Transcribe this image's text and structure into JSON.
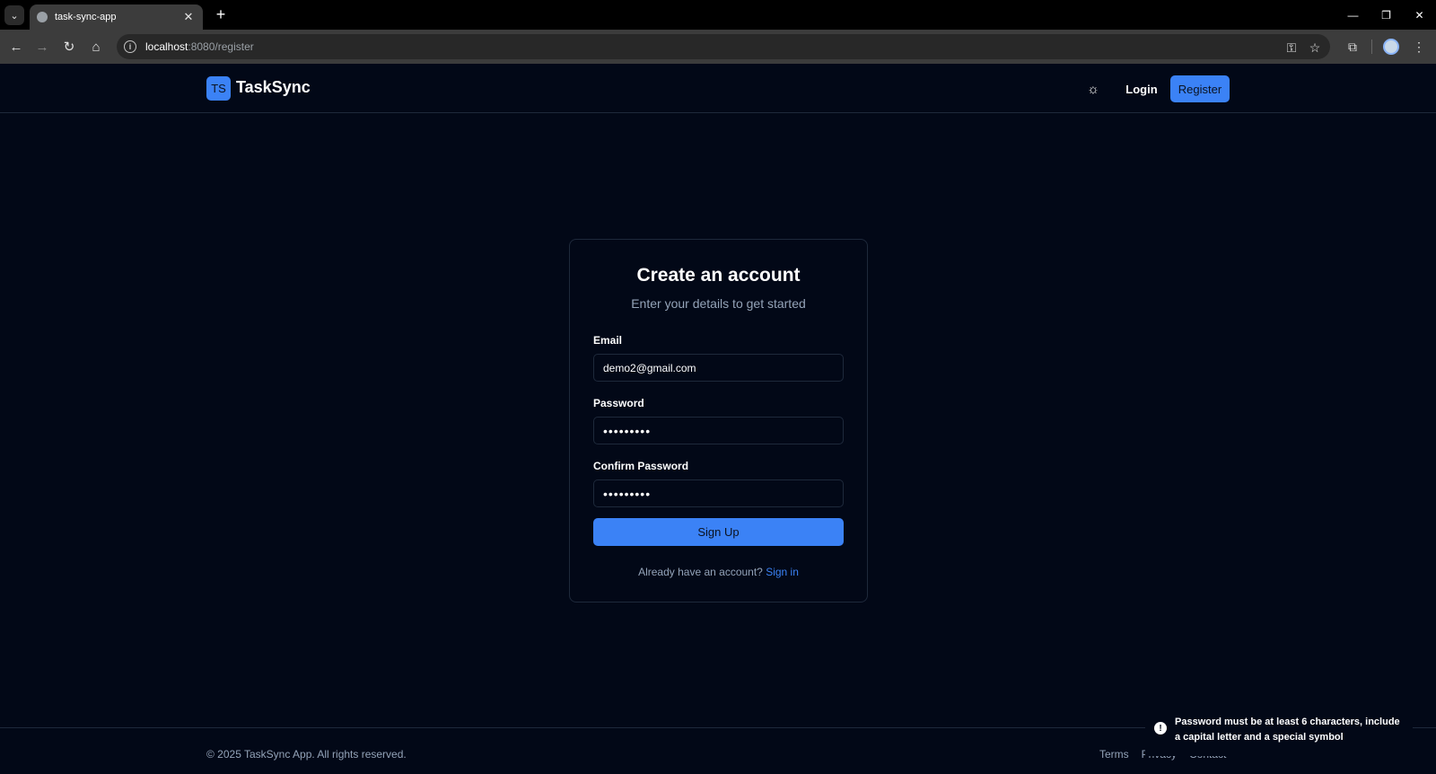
{
  "browser": {
    "tab_title": "task-sync-app",
    "url_host": "localhost",
    "url_rest": ":8080/register"
  },
  "header": {
    "logo_initials": "TS",
    "app_name": "TaskSync",
    "login_label": "Login",
    "register_label": "Register"
  },
  "card": {
    "title": "Create an account",
    "subtitle": "Enter your details to get started",
    "email_label": "Email",
    "email_value": "demo2@gmail.com",
    "password_label": "Password",
    "password_value": "•••••••••",
    "confirm_label": "Confirm Password",
    "confirm_value": "•••••••••",
    "submit_label": "Sign Up",
    "already_text": "Already have an account?",
    "signin_label": "Sign in"
  },
  "footer": {
    "copyright": "© 2025 TaskSync App. All rights reserved.",
    "links": [
      "Terms",
      "Privacy",
      "Contact"
    ]
  },
  "toast": {
    "message": "Password must be at least 6 characters, include a capital letter and a special symbol"
  },
  "colors": {
    "background": "#020817",
    "accent": "#3b82f6",
    "border": "#1e293b",
    "muted_text": "#94a3b8"
  },
  "icons": [
    "tab-search-icon",
    "globe-icon",
    "close-icon",
    "plus-icon",
    "minimize-icon",
    "restore-icon",
    "back-arrow-icon",
    "forward-arrow-icon",
    "reload-icon",
    "home-icon",
    "info-icon",
    "key-icon",
    "star-icon",
    "extensions-icon",
    "kebab-menu-icon",
    "sun-icon",
    "alert-icon"
  ]
}
